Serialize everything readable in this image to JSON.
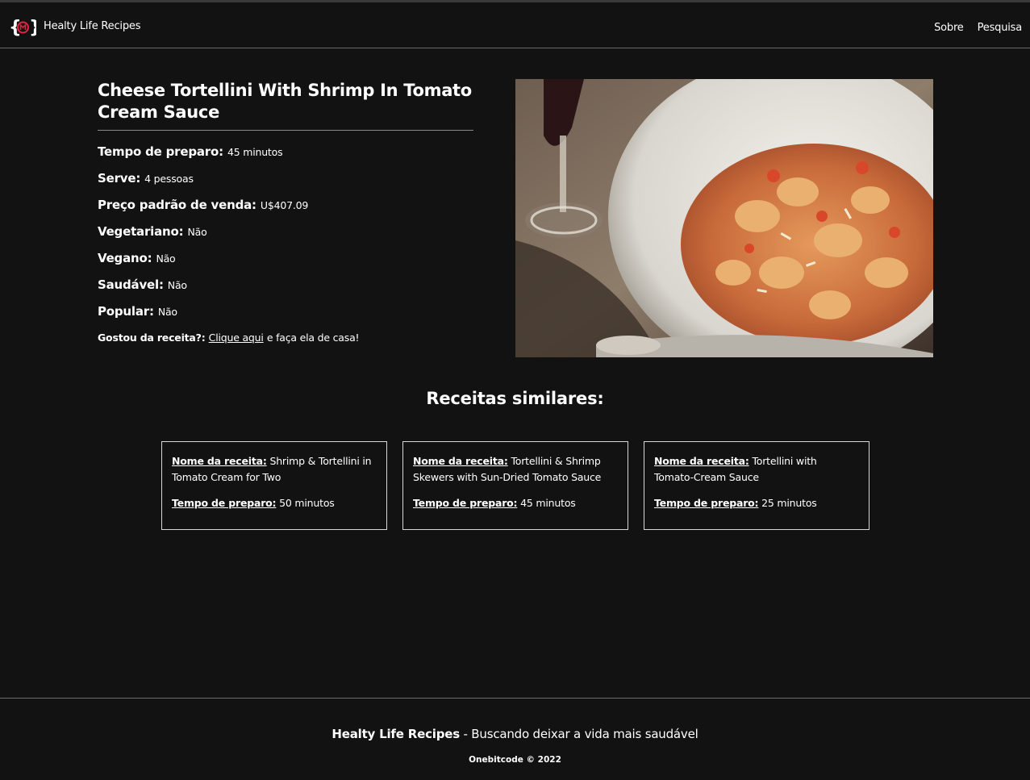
{
  "navbar": {
    "brand": "Healty Life Recipes",
    "links": [
      "Sobre",
      "Pesquisa"
    ],
    "accent_color": "#e8213f"
  },
  "recipe": {
    "title": "Cheese Tortellini With Shrimp In Tomato Cream Sauce",
    "prep_label": "Tempo de preparo:",
    "prep_value": "45 minutos",
    "serves_label": "Serve:",
    "serves_value": "4 pessoas",
    "price_label": "Preço padrão de venda:",
    "price_value": "U$407.09",
    "vegetarian_label": "Vegetariano:",
    "vegetarian_value": "Não",
    "vegan_label": "Vegano:",
    "vegan_value": "Não",
    "healthy_label": "Saudável:",
    "healthy_value": "Não",
    "popular_label": "Popular:",
    "popular_value": "Não",
    "liked_label": "Gostou da receita?:",
    "liked_link": "Clique aqui",
    "liked_tail": "e faça ela de casa!"
  },
  "similar": {
    "title": "Receitas similares:",
    "name_label": "Nome da receita:",
    "time_label": "Tempo de preparo:",
    "cards": [
      {
        "name": "Shrimp & Tortellini in Tomato Cream for Two",
        "time": "50 minutos"
      },
      {
        "name": "Tortellini & Shrimp Skewers with Sun-Dried Tomato Sauce",
        "time": "45 minutos"
      },
      {
        "name": "Tortellini with Tomato-Cream Sauce",
        "time": "25 minutos"
      }
    ]
  },
  "footer": {
    "brand": "Healty Life Recipes",
    "tagline": "- Buscando deixar a vida mais saudável",
    "copyright": "Onebitcode © 2022"
  }
}
